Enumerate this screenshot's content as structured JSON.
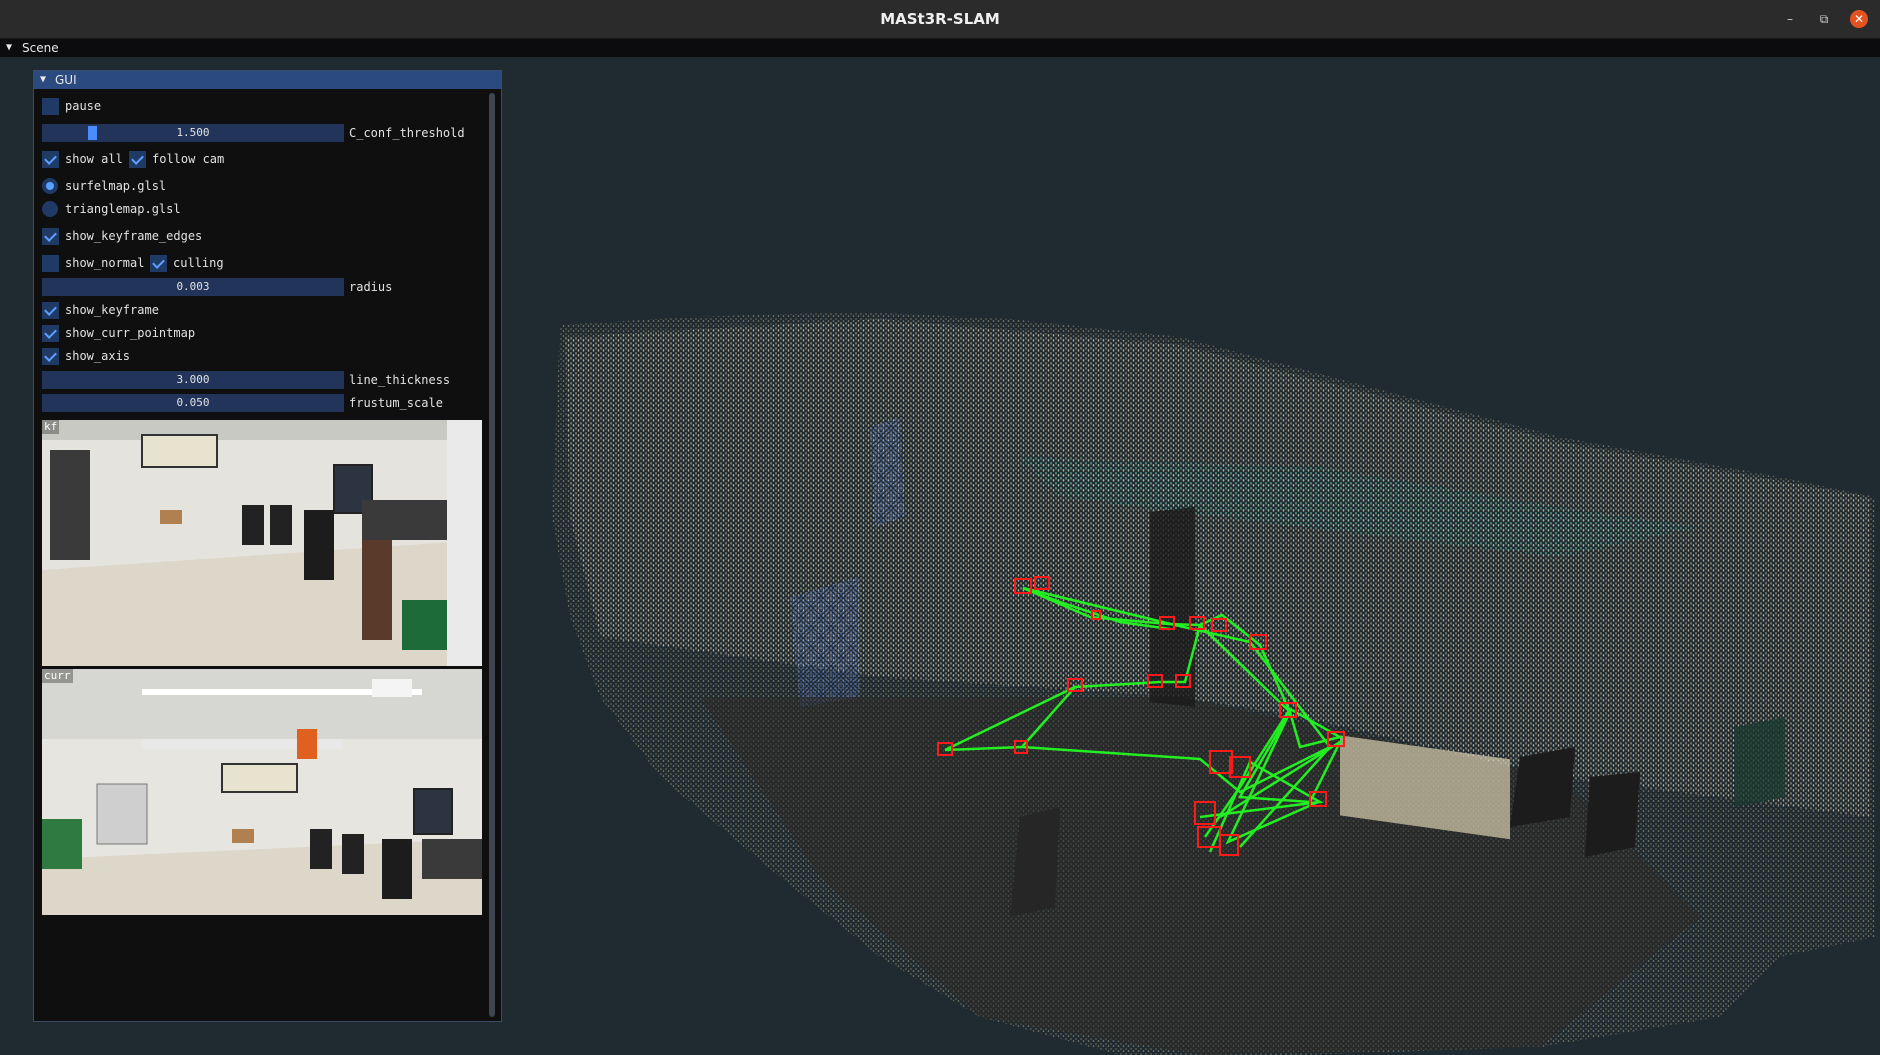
{
  "window": {
    "title": "MASt3R-SLAM",
    "minimize": "–",
    "restore": "⧉",
    "close": "✕"
  },
  "scene": {
    "label": "Scene",
    "arrow": "▼"
  },
  "gui": {
    "title": "GUI",
    "arrow": "▼",
    "pause_label": "pause",
    "c_conf": {
      "value": "1.500",
      "label": "C_conf_threshold",
      "fraction": 0.17
    },
    "show_all_label": "show all",
    "follow_cam_label": "follow cam",
    "surfelmap_label": "surfelmap.glsl",
    "trianglemap_label": "trianglemap.glsl",
    "show_keyframe_edges_label": "show_keyframe_edges",
    "show_normal_label": "show_normal",
    "culling_label": "culling",
    "radius": {
      "value": "0.003",
      "label": "radius"
    },
    "show_keyframe_label": "show_keyframe",
    "show_curr_pointmap_label": "show_curr_pointmap",
    "show_axis_label": "show_axis",
    "line_thickness": {
      "value": "3.000",
      "label": "line_thickness"
    },
    "frustum_scale": {
      "value": "0.050",
      "label": "frustum_scale"
    },
    "kf_label": "kf",
    "curr_label": "curr",
    "states": {
      "pause": false,
      "show_all": true,
      "follow_cam": true,
      "surfelmap": true,
      "trianglemap": false,
      "show_keyframe_edges": true,
      "show_normal": false,
      "culling": true,
      "show_keyframe": true,
      "show_curr_pointmap": true,
      "show_axis": true
    }
  },
  "colors": {
    "accent": "#4a8cff",
    "frustum": "#ff1a1a",
    "edges": "#22ee22",
    "panel": "#0f0f10"
  }
}
